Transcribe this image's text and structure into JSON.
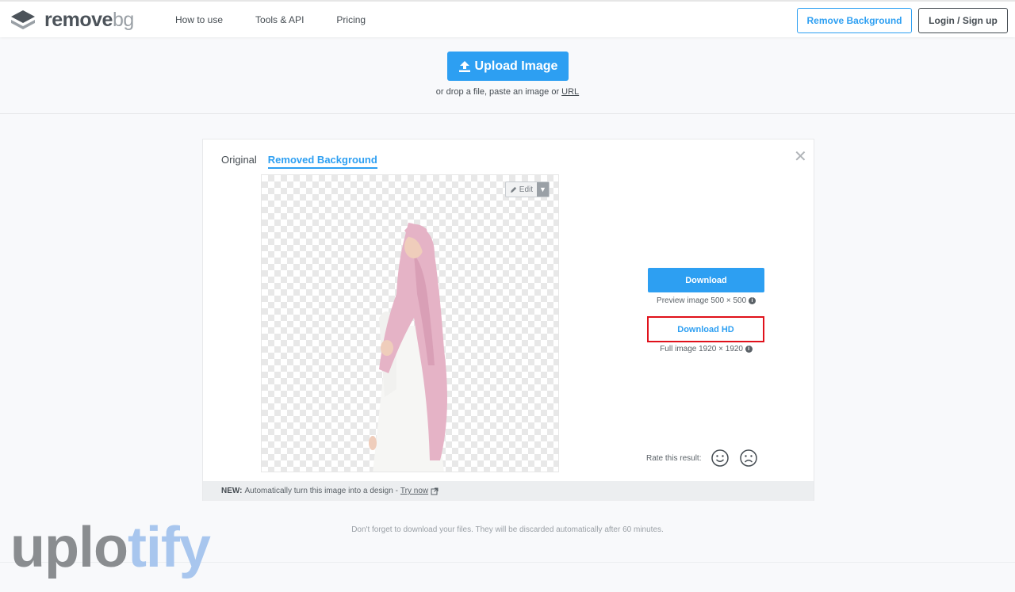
{
  "header": {
    "logo_text_main": "remove",
    "logo_text_accent": "bg",
    "nav": [
      "How to use",
      "Tools & API",
      "Pricing"
    ],
    "remove_background_label": "Remove Background",
    "login_label": "Login / Sign up"
  },
  "upload": {
    "button_label": "Upload Image",
    "hint_prefix": "or drop a file, paste an image or",
    "hint_link": "URL"
  },
  "result": {
    "tabs": [
      "Original",
      "Removed Background"
    ],
    "active_tab": "Removed Background",
    "edit_label": "Edit",
    "download_label": "Download",
    "preview_note": "Preview image 500 × 500",
    "download_hd_label": "Download HD",
    "full_note": "Full image 1920 × 1920",
    "rate_label": "Rate this result:",
    "footer_new": "NEW:",
    "footer_text": "Automatically turn this image into a design -",
    "footer_link": "Try now"
  },
  "bottom_note": "Don't forget to download your files. They will be discarded automatically after 60 minutes.",
  "watermark": {
    "part1": "uplo",
    "part2": "tify"
  },
  "colors": {
    "accent": "#2d9ff2",
    "highlight": "#e0111b",
    "text": "#454c52"
  },
  "icons": [
    "logo-layers-icon",
    "upload-icon",
    "close-icon",
    "pencil-icon",
    "caret-down-icon",
    "info-icon",
    "smile-icon",
    "frown-icon",
    "external-link-icon"
  ]
}
